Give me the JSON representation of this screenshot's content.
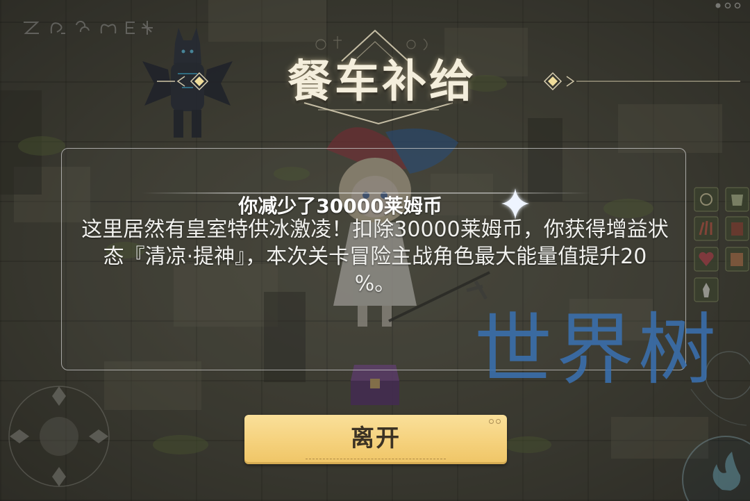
{
  "title": "餐车补给",
  "dialog": {
    "heading": "你减少了30000莱姆币",
    "body_lines": [
      "这里居然有皇室特供冰激凌！扣除30000莱姆币，你获得增益状",
      "态『清凉·提神』，本次关卡冒险主战角色最大能量值提升20",
      "%。"
    ]
  },
  "buttons": {
    "leave": "离开"
  },
  "watermark": "世界树",
  "colors": {
    "title": "#f4eedc",
    "panel_border": "#cfcfcf",
    "button_fill": "#f5d17c",
    "button_text": "#3b3224",
    "watermark": "#3a70af",
    "ornament_gold": "#f0dd9a"
  },
  "icons": {
    "title_ornaments": [
      "diamond-icon",
      "arrow-left-icon",
      "arrow-right-icon"
    ],
    "heading_decoration": "sparkle-icon",
    "menu": "more-dots-icon",
    "movement": "joystick-icon",
    "skill": "fire-skill-icon",
    "inventory": [
      "relic-icon",
      "claw-icon",
      "heart-icon",
      "figure-icon",
      "scroll-icon",
      "mask-icon",
      "book-icon"
    ],
    "runes": [
      "rune-icon"
    ]
  }
}
